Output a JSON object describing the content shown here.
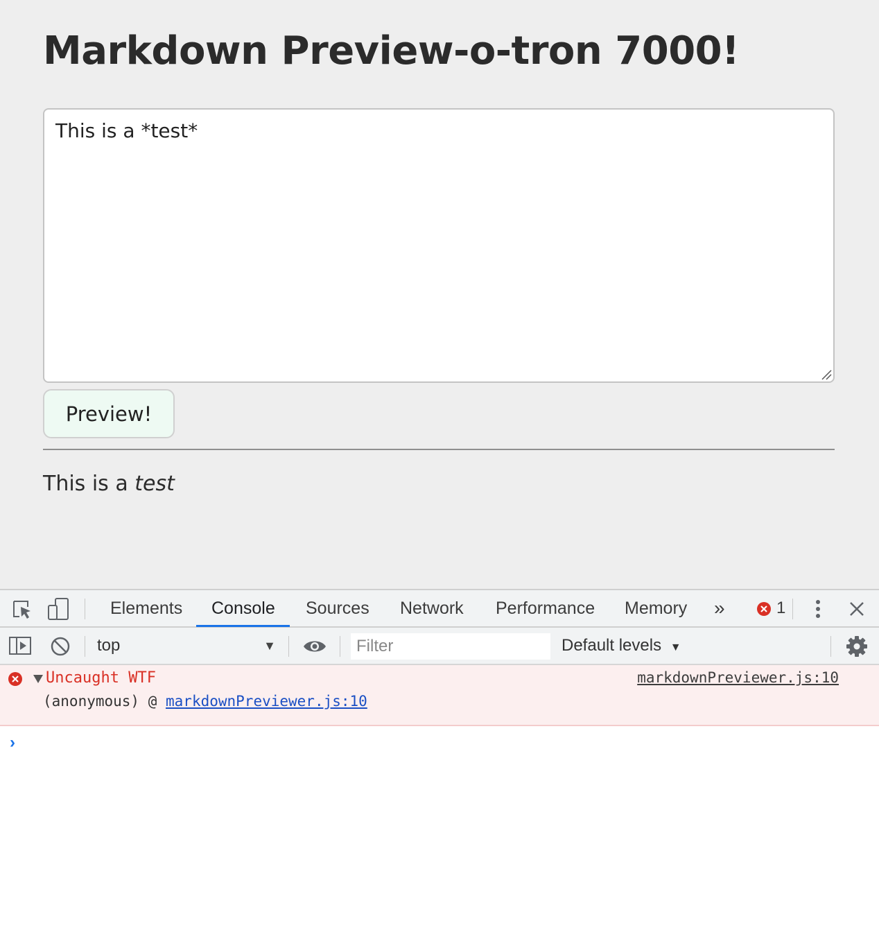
{
  "page": {
    "title": "Markdown Preview-o-tron 7000!",
    "editor_value": "This is a *test*",
    "preview_button": "Preview!",
    "output_prefix": "This is a ",
    "output_emphasis": "test"
  },
  "devtools": {
    "tabs": [
      "Elements",
      "Console",
      "Sources",
      "Network",
      "Performance",
      "Memory"
    ],
    "active_tab": "Console",
    "more_tabs_glyph": "»",
    "error_count": "1",
    "context": "top",
    "filter_placeholder": "Filter",
    "levels": "Default levels",
    "error": {
      "message": "Uncaught WTF",
      "source": "markdownPreviewer.js:10",
      "stack_prefix": "(anonymous) @ ",
      "stack_link": "markdownPreviewer.js:10"
    },
    "prompt_glyph": "›"
  },
  "colors": {
    "error_red": "#d93025",
    "accent_blue": "#1a73e8",
    "error_bg": "#fcefef"
  }
}
